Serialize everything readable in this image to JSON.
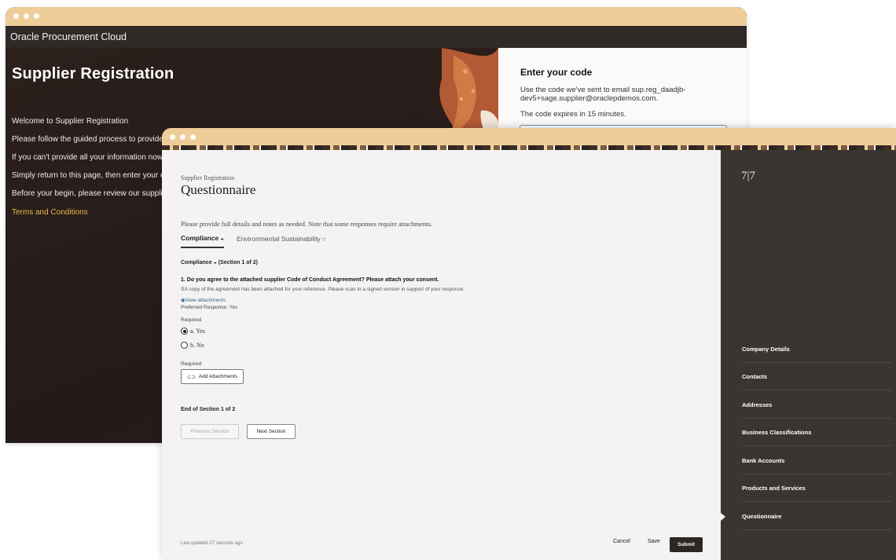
{
  "back_window": {
    "app_title": "Oracle Procurement Cloud",
    "page_title": "Supplier Registration",
    "lines": [
      "Welcome to Supplier Registration",
      "Please follow the guided process to provide y",
      "If you can't provide all your information now, y",
      "Simply return to this page, then enter your em",
      "Before your begin, please review our supplier"
    ],
    "terms_link": "Terms and Conditions",
    "code_panel": {
      "title": "Enter your code",
      "message": "Use the code we've sent to email sup.reg_daadjb-dev5+sage.supplier@oraclepdemos.com.",
      "expiry": "The code expires in 15 minutes."
    }
  },
  "front_window": {
    "breadcrumb": "Supplier Registration",
    "title": "Questionnaire",
    "instructions": "Please provide full details and notes as needed. Note that some responses require attachments.",
    "tabs": [
      {
        "label": "Compliance",
        "icon": "◒"
      },
      {
        "label": "Environmental Sustainability",
        "icon": "○"
      }
    ],
    "section_heading": "Compliance ◒ (Section 1 of 2)",
    "question": "1. Do you agree to the attached supplier Code of Conduct Agreement? Please attach your consent.",
    "hint": "A copy of the agreement has been attached for your reference. Please scan in a signed version in support of your response.",
    "view_attachments": "View attachments",
    "preferred_response": "Preferred Response: Yes",
    "required_label": "Required",
    "options": [
      {
        "label": "a. Yes",
        "selected": true
      },
      {
        "label": "b. No",
        "selected": false
      }
    ],
    "add_attachments": "Add Attachments",
    "end_of_section": "End of Section 1 of 2",
    "previous_section": "Previous Section",
    "next_section": "Next Section",
    "last_updated": "Last updated 27 seconds ago",
    "cancel": "Cancel",
    "save": "Save",
    "submit": "Submit",
    "step_count": "7|7",
    "nav_items": [
      "Company Details",
      "Contacts",
      "Addresses",
      "Business Classifications",
      "Bank Accounts",
      "Products and Services",
      "Questionnaire"
    ],
    "active_nav": "Questionnaire"
  }
}
